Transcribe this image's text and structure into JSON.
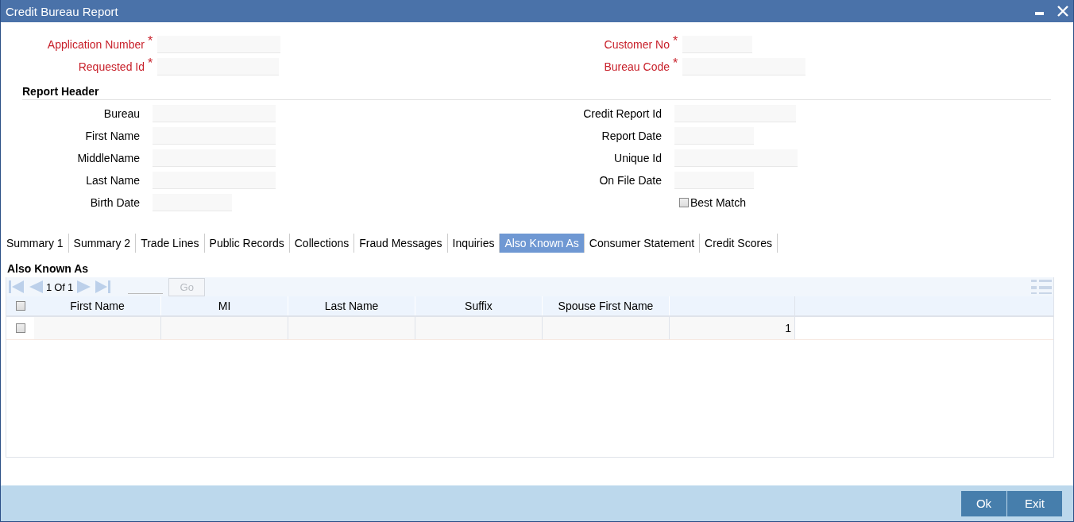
{
  "window": {
    "title": "Credit Bureau Report"
  },
  "top_fields": [
    {
      "label": "Application Number",
      "mark": "*"
    },
    {
      "label": "Customer No",
      "mark": "*"
    },
    {
      "label": "Requested Id",
      "mark": "*"
    },
    {
      "label": "Bureau Code",
      "mark": "*"
    }
  ],
  "report_header": {
    "title": "Report Header",
    "left": [
      {
        "label": "Bureau"
      },
      {
        "label": "First Name"
      },
      {
        "label": "MiddleName"
      },
      {
        "label": "Last Name"
      },
      {
        "label": "Birth Date"
      }
    ],
    "right": [
      {
        "label": "Credit Report Id"
      },
      {
        "label": "Report Date"
      },
      {
        "label": "Unique Id"
      },
      {
        "label": "On File Date"
      }
    ],
    "best_match": {
      "label": "Best Match",
      "checked": false
    }
  },
  "tabs": [
    {
      "label": "Summary 1",
      "selected": false
    },
    {
      "label": "Summary 2",
      "selected": false
    },
    {
      "label": "Trade Lines",
      "selected": false
    },
    {
      "label": "Public Records",
      "selected": false
    },
    {
      "label": "Collections",
      "selected": false
    },
    {
      "label": "Fraud Messages",
      "selected": false
    },
    {
      "label": "Inquiries",
      "selected": false
    },
    {
      "label": "Also Known As",
      "selected": true
    },
    {
      "label": "Consumer Statement",
      "selected": false
    },
    {
      "label": "Credit Scores",
      "selected": false
    }
  ],
  "section": {
    "title": "Also Known As",
    "pager": {
      "current": "1",
      "of": "Of",
      "total": "1",
      "go": "Go",
      "go_disabled": true
    },
    "table": {
      "columns": [
        "First Name",
        "MI",
        "Last Name",
        "Suffix",
        "Spouse First Name"
      ],
      "header_checked": false,
      "rows": [
        {
          "checked": false,
          "column_6": "1"
        }
      ]
    }
  },
  "buttons": [
    "Ok",
    "Exit"
  ]
}
